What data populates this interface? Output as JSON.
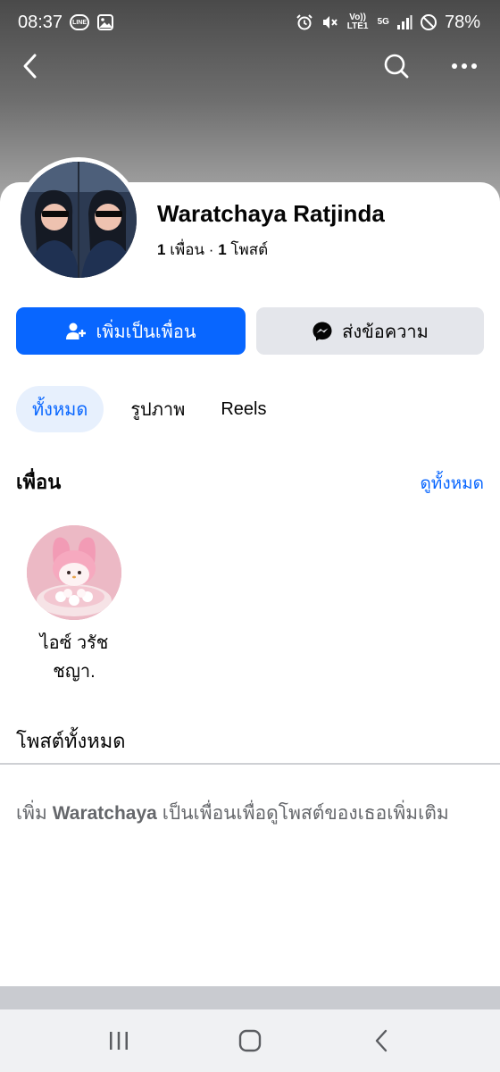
{
  "status_bar": {
    "time": "08:37",
    "line_badge": "LINE",
    "net_volte": "Vo)) LTE1",
    "net_5g": "5G",
    "battery": "78%"
  },
  "profile": {
    "name": "Waratchaya Ratjinda",
    "friends_count": "1",
    "friends_word": "เพื่อน",
    "separator": "·",
    "posts_count": "1",
    "posts_word": "โพสต์"
  },
  "actions": {
    "add_friend_label": "เพิ่มเป็นเพื่อน",
    "message_label": "ส่งข้อความ"
  },
  "tabs": [
    {
      "label": "ทั้งหมด",
      "active": true
    },
    {
      "label": "รูปภาพ",
      "active": false
    },
    {
      "label": "Reels",
      "active": false
    }
  ],
  "friends_section": {
    "title": "เพื่อน",
    "see_all": "ดูทั้งหมด",
    "friends": [
      {
        "name_line1": "ไอซ์ วรัช",
        "name_line2": "ชญา."
      }
    ]
  },
  "posts_section": {
    "title": "โพสต์ทั้งหมด",
    "message_prefix": "เพิ่ม",
    "message_name": "Waratchaya",
    "message_suffix": "เป็นเพื่อนเพื่อดูโพสต์ของเธอเพิ่มเติม"
  },
  "colors": {
    "accent": "#0866ff",
    "secondary_button": "#e4e6eb",
    "tab_active_bg": "#e7f0fd",
    "muted_text": "#65676b"
  },
  "icons": {
    "back": "chevron-left-icon",
    "search": "search-icon",
    "more": "more-dots-icon",
    "add_friend": "add-person-icon",
    "messenger": "messenger-icon"
  }
}
